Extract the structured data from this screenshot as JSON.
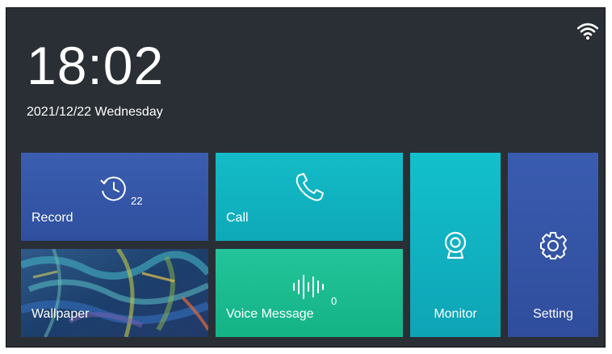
{
  "status": {
    "time": "18:02",
    "date": "2021/12/22 Wednesday",
    "wifi_icon": "wifi-icon"
  },
  "tiles": {
    "record": {
      "label": "Record",
      "icon": "history-clock-icon",
      "count": "22",
      "color": "#3556a8"
    },
    "call": {
      "label": "Call",
      "icon": "phone-icon",
      "color": "#11b3c1"
    },
    "monitor": {
      "label": "Monitor",
      "icon": "camera-icon",
      "color": "#11b3c1"
    },
    "setting": {
      "label": "Setting",
      "icon": "gear-icon",
      "color": "#3556a8"
    },
    "wallpaper": {
      "label": "Wallpaper",
      "icon": "abstract-painting-image"
    },
    "voice_message": {
      "label": "Voice Message",
      "icon": "voice-wave-icon",
      "count": "0",
      "color": "#1dbb91"
    }
  }
}
